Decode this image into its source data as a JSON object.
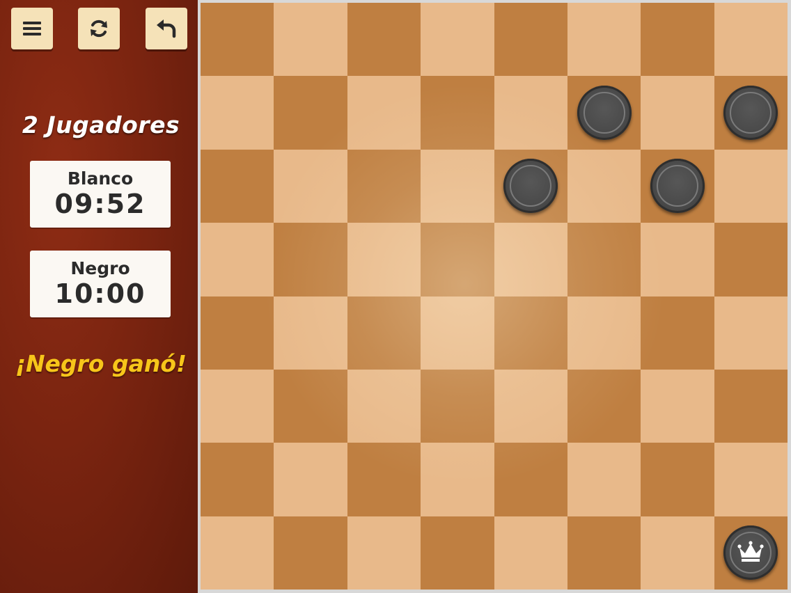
{
  "toolbar": {
    "menu_icon": "hamburger-menu-icon",
    "restart_icon": "refresh-icon",
    "undo_icon": "undo-arrow-icon"
  },
  "mode_title": "2 Jugadores",
  "clocks": [
    {
      "player": "Blanco",
      "time": "09:52"
    },
    {
      "player": "Negro",
      "time": "10:00"
    }
  ],
  "status_text": "¡Negro ganó!",
  "colors": {
    "sidebar": "#7a2410",
    "button_bg": "#f5e2b8",
    "status": "#f7c61a",
    "light_square": "#e8b98a",
    "dark_square": "#bf7f41",
    "black_piece": "#4a4a4a"
  },
  "board": {
    "size": 8,
    "pieces": [
      {
        "row": 1,
        "col": 5,
        "color": "black",
        "king": false
      },
      {
        "row": 1,
        "col": 7,
        "color": "black",
        "king": false
      },
      {
        "row": 2,
        "col": 4,
        "color": "black",
        "king": false
      },
      {
        "row": 2,
        "col": 6,
        "color": "black",
        "king": false
      },
      {
        "row": 7,
        "col": 7,
        "color": "black",
        "king": true
      }
    ]
  }
}
